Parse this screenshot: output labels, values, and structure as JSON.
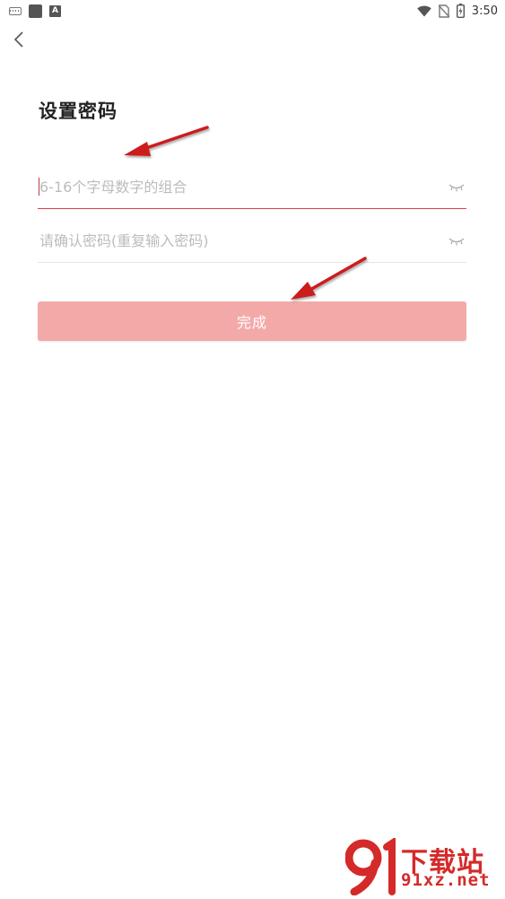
{
  "status_bar": {
    "time": "3:50",
    "left_icons": [
      "keyboard-icon",
      "square-icon",
      "a-icon"
    ],
    "a_icon_label": "A",
    "right_icons": [
      "wifi-icon",
      "no-sim-icon",
      "battery-icon"
    ]
  },
  "header": {
    "back_icon": "chevron-left-icon"
  },
  "page": {
    "title": "设置密码"
  },
  "form": {
    "password": {
      "placeholder": "6-16个字母数字的组合",
      "value": "",
      "visibility_icon": "eye-closed-icon"
    },
    "confirm_password": {
      "placeholder": "请确认密码(重复输入密码)",
      "value": "",
      "visibility_icon": "eye-closed-icon"
    },
    "submit_label": "完成"
  },
  "watermark": {
    "line1": "下载站",
    "line2": "91xz.net"
  },
  "colors": {
    "accent": "#d9434a",
    "button_bg": "#f4a9a9",
    "annotation_arrow": "#cc1b1b",
    "placeholder": "#bcbcbc"
  }
}
